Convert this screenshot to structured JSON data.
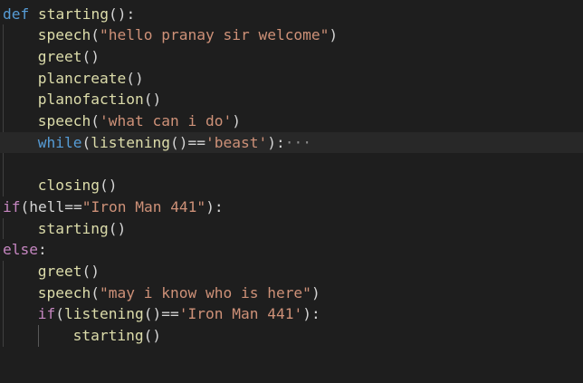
{
  "editor": {
    "lines": [
      {
        "indent": 0,
        "tokens": [
          {
            "t": "def ",
            "c": "kw"
          },
          {
            "t": "starting",
            "c": "fn"
          },
          {
            "t": "():",
            "c": "txt"
          }
        ]
      },
      {
        "indent": 1,
        "tokens": [
          {
            "t": "speech",
            "c": "fn"
          },
          {
            "t": "(",
            "c": "txt"
          },
          {
            "t": "\"hello pranay sir welcome\"",
            "c": "str"
          },
          {
            "t": ")",
            "c": "txt"
          }
        ]
      },
      {
        "indent": 1,
        "tokens": [
          {
            "t": "greet",
            "c": "fn"
          },
          {
            "t": "()",
            "c": "txt"
          }
        ]
      },
      {
        "indent": 1,
        "tokens": [
          {
            "t": "plancreate",
            "c": "fn"
          },
          {
            "t": "()",
            "c": "txt"
          }
        ]
      },
      {
        "indent": 1,
        "tokens": [
          {
            "t": "planofaction",
            "c": "fn"
          },
          {
            "t": "()",
            "c": "txt"
          }
        ]
      },
      {
        "indent": 1,
        "tokens": [
          {
            "t": "speech",
            "c": "fn"
          },
          {
            "t": "(",
            "c": "txt"
          },
          {
            "t": "'what can i do'",
            "c": "str"
          },
          {
            "t": ")",
            "c": "txt"
          }
        ]
      },
      {
        "indent": 1,
        "current": true,
        "tokens": [
          {
            "t": "while",
            "c": "kw"
          },
          {
            "t": "(",
            "c": "txt"
          },
          {
            "t": "listening",
            "c": "fn"
          },
          {
            "t": "()==",
            "c": "txt"
          },
          {
            "t": "'beast'",
            "c": "str"
          },
          {
            "t": "):",
            "c": "txt"
          },
          {
            "t": "···",
            "c": "ellipsis"
          }
        ]
      },
      {
        "indent": 0,
        "tokens": []
      },
      {
        "indent": 1,
        "tokens": [
          {
            "t": "closing",
            "c": "fn"
          },
          {
            "t": "()",
            "c": "txt"
          }
        ]
      },
      {
        "indent": 0,
        "tokens": [
          {
            "t": "if",
            "c": "kw2"
          },
          {
            "t": "(hell==",
            "c": "txt"
          },
          {
            "t": "\"Iron Man 441\"",
            "c": "str"
          },
          {
            "t": "):",
            "c": "txt"
          }
        ]
      },
      {
        "indent": 1,
        "tokens": [
          {
            "t": "starting",
            "c": "fn"
          },
          {
            "t": "()",
            "c": "txt"
          }
        ]
      },
      {
        "indent": 0,
        "tokens": [
          {
            "t": "else",
            "c": "kw2"
          },
          {
            "t": ":",
            "c": "txt"
          }
        ]
      },
      {
        "indent": 1,
        "tokens": [
          {
            "t": "greet",
            "c": "fn"
          },
          {
            "t": "()",
            "c": "txt"
          }
        ]
      },
      {
        "indent": 1,
        "tokens": [
          {
            "t": "speech",
            "c": "fn"
          },
          {
            "t": "(",
            "c": "txt"
          },
          {
            "t": "\"may i know who is here\"",
            "c": "str"
          },
          {
            "t": ")",
            "c": "txt"
          }
        ]
      },
      {
        "indent": 1,
        "tokens": [
          {
            "t": "if",
            "c": "kw2"
          },
          {
            "t": "(",
            "c": "txt"
          },
          {
            "t": "listening",
            "c": "fn"
          },
          {
            "t": "()==",
            "c": "txt"
          },
          {
            "t": "'Iron Man 441'",
            "c": "str"
          },
          {
            "t": "):",
            "c": "txt"
          }
        ]
      },
      {
        "indent": 2,
        "tokens": [
          {
            "t": "starting",
            "c": "fn"
          },
          {
            "t": "()",
            "c": "txt"
          }
        ]
      }
    ],
    "colors": {
      "background": "#1e1e1e",
      "current_line": "#282828",
      "keyword": "#569cd6",
      "control_keyword": "#c586c0",
      "function": "#dcdcaa",
      "string": "#ce9178",
      "text": "#d4d4d4"
    }
  }
}
